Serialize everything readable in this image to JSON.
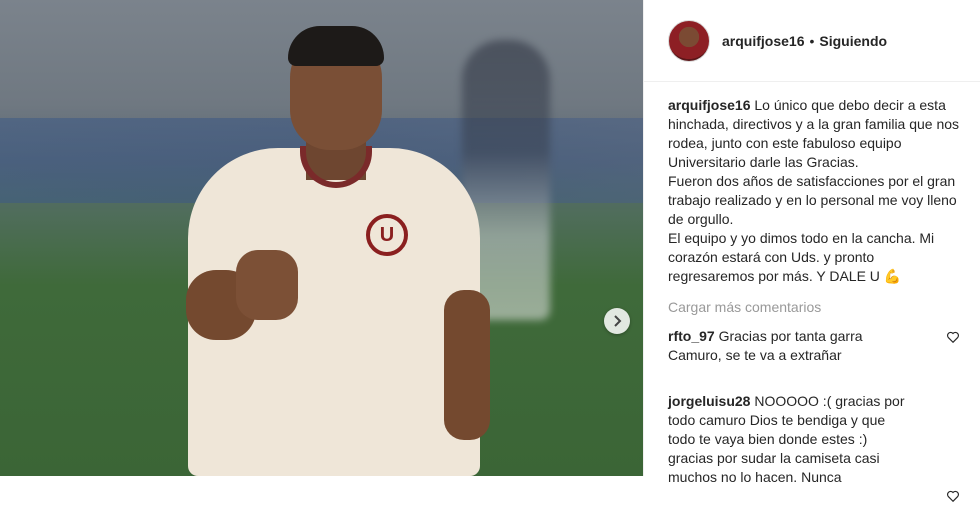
{
  "post": {
    "author": "arquifjose16",
    "separator": "•",
    "follow_status": "Siguiendo",
    "caption_user": "arquifjose16",
    "caption_text": "Lo único que debo decir a esta hinchada, directivos y a la gran familia que nos rodea, junto con este fabuloso equipo Universitario darle las Gracias.\nFueron dos años de satisfacciones por el gran trabajo realizado y en lo personal me voy lleno de orgullo.\nEl equipo y yo dimos todo en la cancha. Mi corazón estará con Uds. y pronto regresaremos por más. Y DALE U 💪",
    "load_more": "Cargar más comentarios"
  },
  "comments": [
    {
      "user": "rfto_97",
      "text": "Gracias por tanta garra\nCamuro, se te va a extrañar"
    },
    {
      "user": "jorgeluisu28",
      "text": "NOOOOO :( gracias por\ntodo camuro Dios te bendiga y que\ntodo te vaya bien donde estes :)\ngracias por sudar la camiseta casi\nmuchos no lo hacen. Nunca"
    }
  ],
  "photo": {
    "crest_letter": "U",
    "next_icon": "chevron-right-icon"
  },
  "colors": {
    "text": "#262626",
    "muted": "#999999",
    "border": "#efefef"
  }
}
